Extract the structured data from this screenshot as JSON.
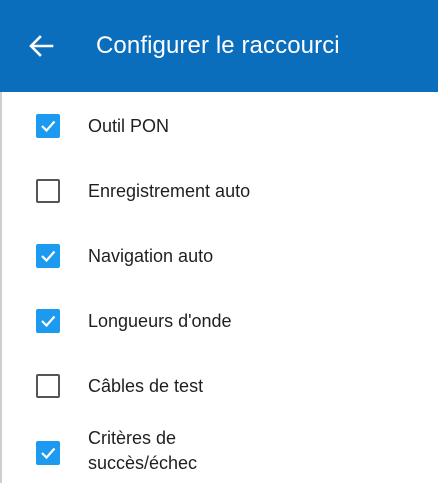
{
  "header": {
    "title": "Configurer le raccourci",
    "back_icon": "arrow-left-icon",
    "background_color": "#0a6ebd"
  },
  "options": [
    {
      "label": "Outil PON",
      "checked": true
    },
    {
      "label": "Enregistrement auto",
      "checked": false
    },
    {
      "label": "Navigation auto",
      "checked": true
    },
    {
      "label": "Longueurs d'onde",
      "checked": true
    },
    {
      "label": "Câbles de test",
      "checked": false
    },
    {
      "label": "Critères de\nsuccès/échec",
      "checked": true
    }
  ],
  "colors": {
    "checked": "#1b9aef",
    "unchecked_border": "#555555"
  }
}
